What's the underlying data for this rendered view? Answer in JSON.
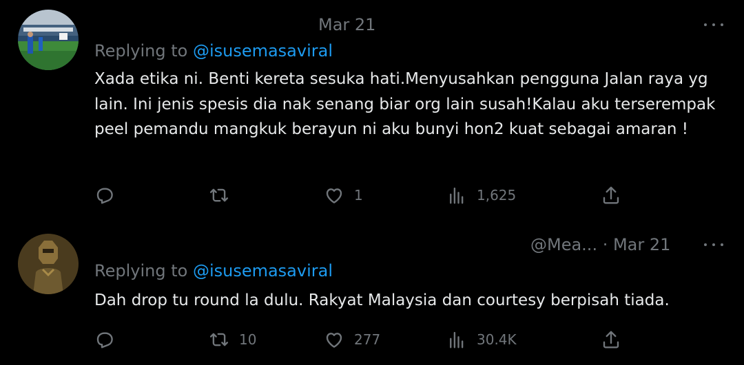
{
  "tweets": [
    {
      "id": "tweet-1",
      "meta": "Mar 21",
      "replying_prefix": "Replying to ",
      "replying_handle": "@isusemasaviral",
      "text": "Xada etika ni. Benti kereta sesuka hati.Menyusahkan pengguna Jalan raya yg lain. Ini jenis spesis dia nak senang biar org lain susah!Kalau aku terserempak peel pemandu mangkuk berayun ni aku bunyi hon2 kuat sebagai amaran !",
      "replies": "",
      "retweets": "",
      "likes": "1",
      "views": "1,625",
      "avatar_icon": "stadium-photo-avatar"
    },
    {
      "id": "tweet-2",
      "meta": "@Mea... · Mar 21",
      "replying_prefix": "Replying to ",
      "replying_handle": "@isusemasaviral",
      "text": "Dah drop tu round la dulu. Rakyat Malaysia dan courtesy berpisah tiada.",
      "replies": "",
      "retweets": "10",
      "likes": "277",
      "views": "30.4K",
      "avatar_icon": "statue-photo-avatar"
    }
  ],
  "colors": {
    "background": "#000000",
    "text": "#e7e9ea",
    "muted": "#71767b",
    "link": "#1d9bf0"
  },
  "icons": [
    "reply-icon",
    "retweet-icon",
    "like-icon",
    "views-icon",
    "share-icon",
    "more-icon"
  ]
}
